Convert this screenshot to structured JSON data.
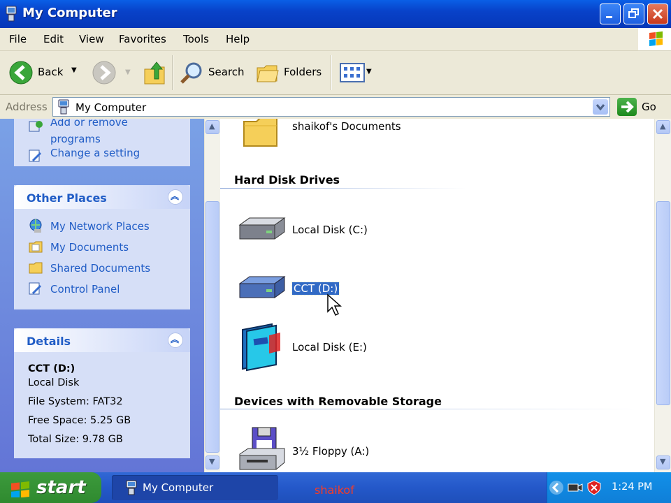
{
  "window": {
    "title": "My Computer"
  },
  "menu": [
    "File",
    "Edit",
    "View",
    "Favorites",
    "Tools",
    "Help"
  ],
  "toolbar": {
    "back_label": "Back",
    "search_label": "Search",
    "folders_label": "Folders"
  },
  "address": {
    "label": "Address",
    "value": "My Computer",
    "go_label": "Go"
  },
  "system_tasks": {
    "items": [
      {
        "label": "Add or remove programs",
        "icon": "add-remove-programs-icon"
      },
      {
        "label": "Change a setting",
        "icon": "control-panel-icon"
      }
    ]
  },
  "other_places": {
    "title": "Other Places",
    "items": [
      {
        "label": "My Network Places",
        "icon": "network-places-icon"
      },
      {
        "label": "My Documents",
        "icon": "my-documents-icon"
      },
      {
        "label": "Shared Documents",
        "icon": "folder-icon"
      },
      {
        "label": "Control Panel",
        "icon": "control-panel-icon"
      }
    ]
  },
  "details": {
    "title": "Details",
    "name": "CCT (D:)",
    "type": "Local Disk",
    "file_system": "File System: FAT32",
    "free_space": "Free Space: 5.25 GB",
    "total_size": "Total Size: 9.78 GB"
  },
  "content": {
    "top_item": "shaikof's Documents",
    "sections": [
      {
        "title": "Hard Disk Drives",
        "items": [
          "Local Disk (C:)",
          "CCT (D:)",
          "Local Disk (E:)"
        ]
      },
      {
        "title": "Devices with Removable Storage",
        "items": [
          "3½ Floppy (A:)"
        ]
      }
    ],
    "selected_item": "CCT (D:)"
  },
  "taskbar": {
    "start_label": "start",
    "window_label": "My Computer",
    "overlay_text": "shaikof",
    "clock": "1:24 PM"
  },
  "colors": {
    "title_bar": "#0842c9",
    "task_link": "#215dc6",
    "selection": "#316ac5",
    "start_button": "#3c9a3c"
  }
}
